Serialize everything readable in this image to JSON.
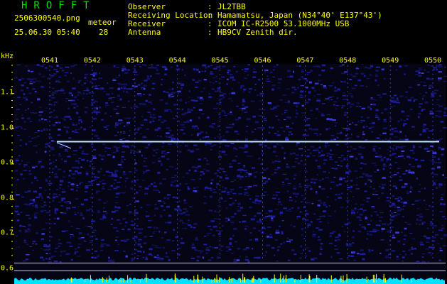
{
  "header": {
    "app_title": "HROFFT",
    "file_name": "2506300540.png",
    "meteor_label": "meteor",
    "timestamp": "25.06.30 05:40",
    "meteor_count": "28"
  },
  "info": {
    "keys": [
      "Observer",
      "Receiving Location",
      "Receiver",
      "Antenna"
    ],
    "separator": ":",
    "values": [
      "JL2TBB",
      "Hamamatsu, Japan (N34°40' E137°43')",
      "ICOM IC-R2500 53.1000MHz USB",
      "HB9CV Zenith dir."
    ]
  },
  "axis": {
    "unit": "kHz",
    "time_ticks": [
      "0541",
      "0542",
      "0543",
      "0544",
      "0545",
      "0546",
      "0547",
      "0548",
      "0549",
      "0550"
    ],
    "freq_ticks": [
      "1.1",
      "1.0",
      "0.9",
      "0.8",
      "0.7",
      "0.6"
    ]
  },
  "colors": {
    "text": "#ffff00",
    "title": "#00e000",
    "background_noise": "#14147a",
    "carrier": "#bfe6ff",
    "spectrum": "#00e0ff",
    "spikes": "#ffff00"
  },
  "spectrogram": {
    "carrier_freq_khz": 0.96,
    "carrier_start": "0541"
  }
}
